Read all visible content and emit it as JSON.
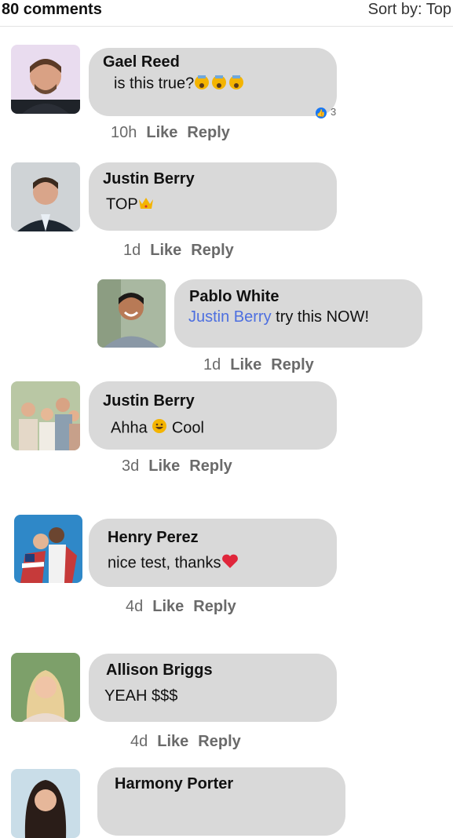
{
  "header": {
    "count": "80 comments",
    "sort": "Sort by: Top"
  },
  "comments": [
    {
      "name": "Gael Reed",
      "text": "is this true?",
      "reactions": "3",
      "time": "10h",
      "like": "Like",
      "reply": "Reply"
    },
    {
      "name": "Justin Berry",
      "text": "TOP",
      "time": "1d",
      "like": "Like",
      "reply": "Reply"
    },
    {
      "name": "Pablo White",
      "mention": "Justin Berry",
      "text": "try this NOW!",
      "time": "1d",
      "like": "Like",
      "reply": "Reply"
    },
    {
      "name": "Justin Berry",
      "text_before": "Ahha",
      "text_after": "Cool",
      "time": "3d",
      "like": "Like",
      "reply": "Reply"
    },
    {
      "name": "Henry Perez",
      "text": "nice test, thanks",
      "time": "4d",
      "like": "Like",
      "reply": "Reply"
    },
    {
      "name": "Allison Briggs",
      "text": "YEAH $$$",
      "time": "4d",
      "like": "Like",
      "reply": "Reply"
    },
    {
      "name": "Harmony Porter"
    }
  ],
  "colors": {
    "bubble": "#d9d9d9",
    "mention": "#4d6fe0",
    "meta": "#6a6a6a",
    "heart": "#e0263b",
    "like_blue": "#1877f2"
  }
}
